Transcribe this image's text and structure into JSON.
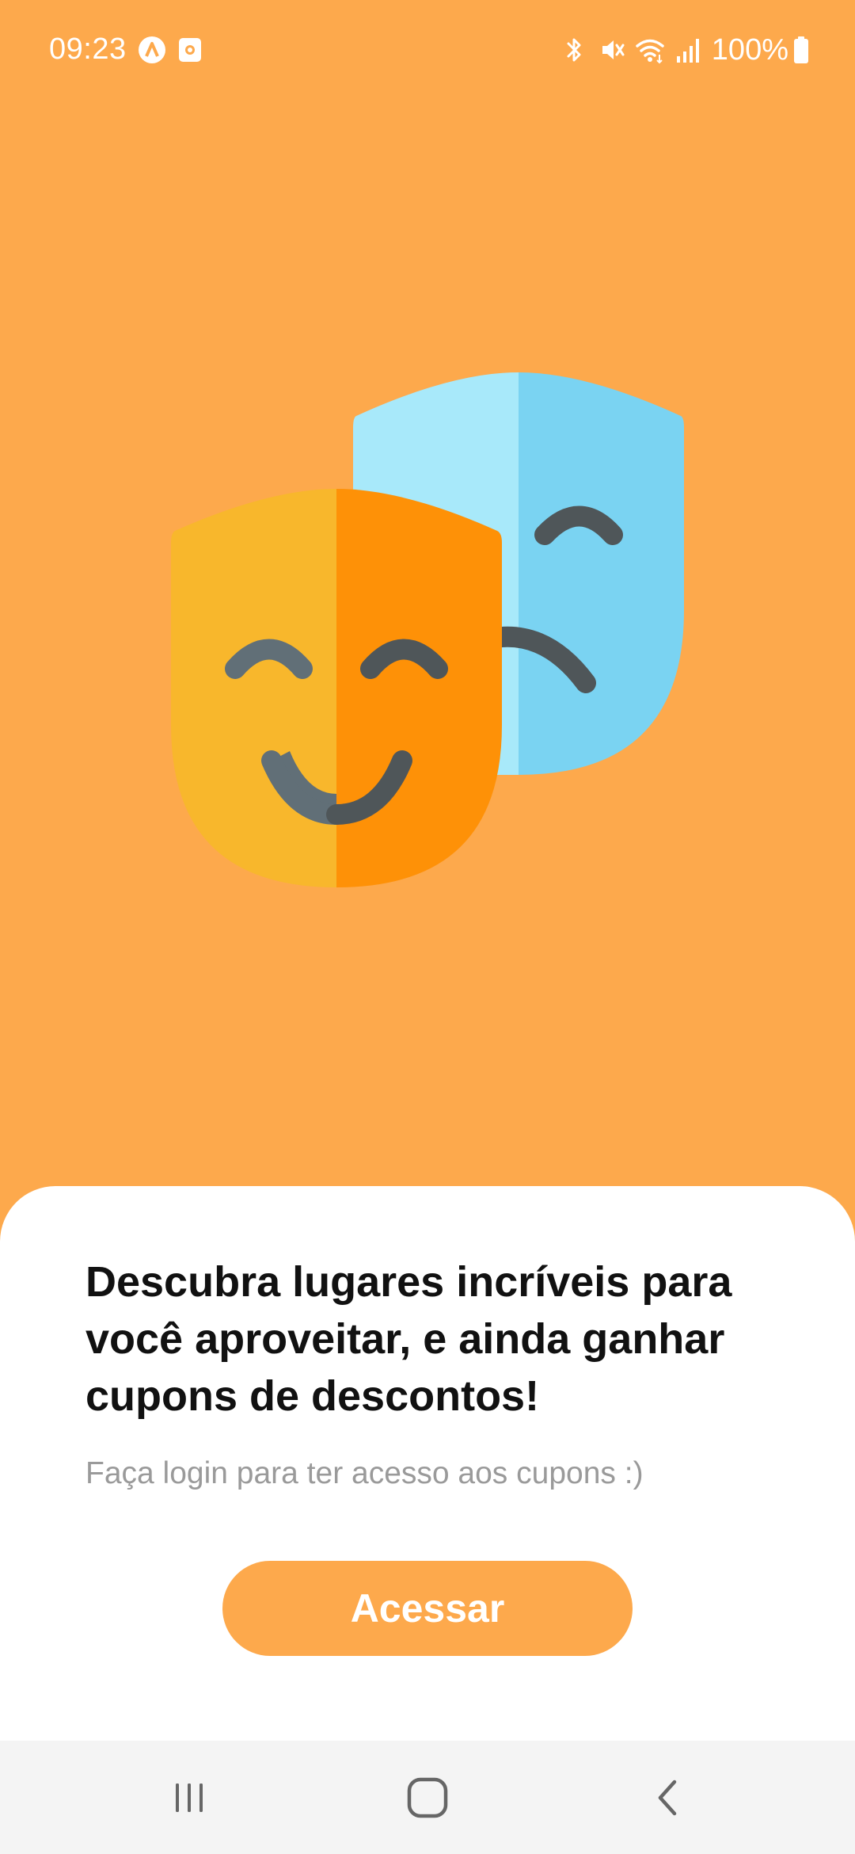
{
  "status_bar": {
    "time": "09:23",
    "left_icons": [
      "app-a-icon",
      "screenshot-icon"
    ],
    "right_icons": [
      "bluetooth-icon",
      "mute-icon",
      "wifi-icon",
      "signal-icon"
    ],
    "battery_text": "100%",
    "battery_icon": "battery-full-icon"
  },
  "illustration": {
    "icon": "theater-masks-icon",
    "colors": {
      "background": "#FDA94C",
      "comedy_light": "#F8B72C",
      "comedy_dark": "#FE9107",
      "tragedy_light": "#A8E9FA",
      "tragedy_dark": "#7AD3F2",
      "features_light": "#616F77",
      "features_dark": "#4F5659"
    }
  },
  "sheet": {
    "headline": "Descubra lugares incríveis para você aproveitar, e ainda ganhar cupons de descontos!",
    "subtext": "Faça login para ter acesso aos cupons :)",
    "button_label": "Acessar"
  },
  "nav_bar": {
    "items": [
      "recent-apps-icon",
      "home-icon",
      "back-icon"
    ]
  },
  "colors": {
    "accent": "#FDA94C",
    "sheet_background": "#FFFFFF",
    "headline_text": "#111111",
    "subtext": "#9A9A9A",
    "nav_background": "#F4F4F4"
  }
}
